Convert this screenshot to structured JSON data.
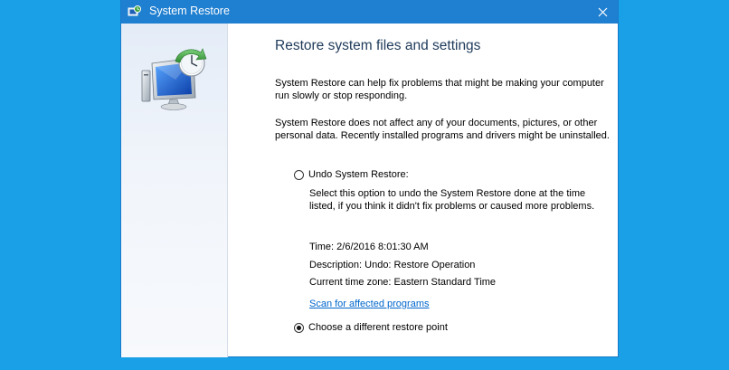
{
  "window": {
    "title": "System Restore",
    "app_icon": "system-restore-icon",
    "close_icon": "close-icon"
  },
  "sidebar": {
    "hero_icon": "system-restore-computer-icon"
  },
  "main": {
    "heading": "Restore system files and settings",
    "paragraph1": "System Restore can help fix problems that might be making your computer run slowly or stop responding.",
    "paragraph2": "System Restore does not affect any of your documents, pictures, or other personal data. Recently installed programs and drivers might be uninstalled.",
    "options": {
      "undo": {
        "label": "Undo System Restore:",
        "selected": false,
        "description": "Select this option to undo the System Restore done at the time listed, if you think it didn't fix problems or caused more problems.",
        "time": "Time: 2/6/2016 8:01:30 AM",
        "restore_description": "Description: Undo: Restore Operation",
        "timezone": "Current time zone: Eastern Standard Time",
        "scan_link": "Scan for affected programs"
      },
      "different": {
        "label": "Choose a different restore point",
        "selected": true
      }
    }
  },
  "colors": {
    "desktop": "#1aa0e6",
    "titlebar": "#1f7fd0",
    "link": "#0066cc",
    "heading": "#1e3a5a"
  }
}
